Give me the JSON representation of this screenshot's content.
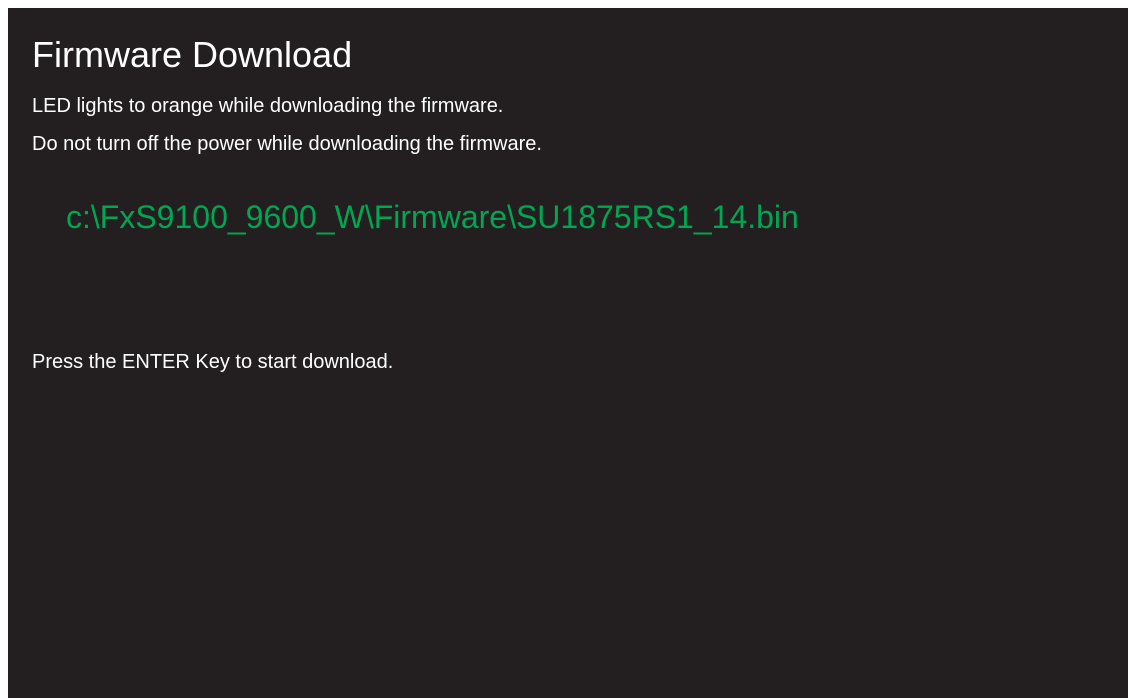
{
  "screen": {
    "title": "Firmware Download",
    "notices": [
      "LED lights to orange while downloading the firmware.",
      "Do not turn off the power while downloading the firmware."
    ],
    "file_path": "c:\\FxS9100_9600_W\\Firmware\\SU1875RS1_14.bin",
    "prompt": "Press the ENTER Key to start download."
  },
  "colors": {
    "background": "#231f20",
    "text": "#ffffff",
    "file_path": "#00a651",
    "page_margin": "#ffffff"
  }
}
